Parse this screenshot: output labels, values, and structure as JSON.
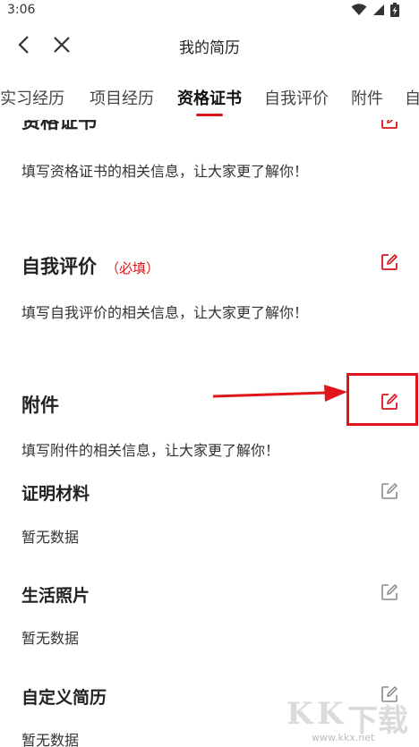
{
  "status_bar": {
    "time": "3:06",
    "icons": [
      "wifi-icon",
      "signal-icon",
      "battery-charging-icon"
    ]
  },
  "header": {
    "title": "我的简历",
    "icons": [
      "back-arrow-icon",
      "close-icon"
    ]
  },
  "tabs": [
    {
      "label": "/实习经历",
      "active": false
    },
    {
      "label": "项目经历",
      "active": false
    },
    {
      "label": "资格证书",
      "active": true
    },
    {
      "label": "自我评价",
      "active": false
    },
    {
      "label": "附件",
      "active": false
    },
    {
      "label": "自",
      "active": false
    }
  ],
  "sections": {
    "certificate": {
      "title": "资格证书",
      "hint": "填写资格证书的相关信息，让大家更了解你！"
    },
    "self_evaluation": {
      "title": "自我评价",
      "required": "（必填）",
      "hint": "填写自我评价的相关信息，让大家更了解你！"
    },
    "attachment": {
      "title": "附件",
      "hint": "填写附件的相关信息，让大家更了解你！",
      "sub_sections": [
        {
          "title": "证明材料",
          "empty_text": "暂无数据"
        },
        {
          "title": "生活照片",
          "empty_text": "暂无数据"
        },
        {
          "title": "自定义简历",
          "empty_text": "暂无数据"
        }
      ]
    }
  },
  "watermark": {
    "letters": [
      "K",
      "K",
      "下",
      "载"
    ],
    "url": "www.kkx.net"
  },
  "colors": {
    "accent": "#d9161e",
    "edit_icon_active": "#d9161e",
    "edit_icon_inactive": "#8a8a8a",
    "annotation": "#e0151c"
  }
}
